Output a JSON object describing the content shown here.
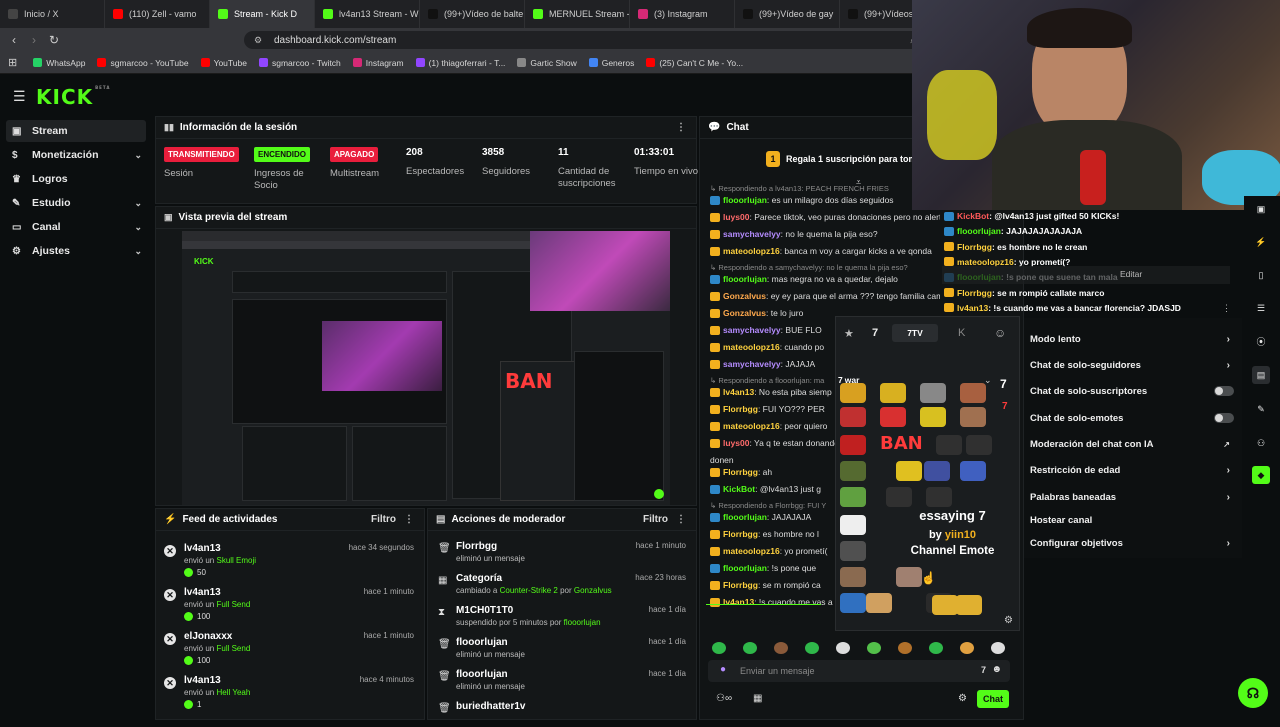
{
  "browser": {
    "tabs": [
      {
        "label": "Inicio / X",
        "color": "#444"
      },
      {
        "label": "(110) Zell - vamo",
        "color": "#ff0000"
      },
      {
        "label": "Stream - Kick D",
        "color": "#53fc18",
        "active": true
      },
      {
        "label": "lv4an13 Stream - W",
        "color": "#53fc18"
      },
      {
        "label": "(99+)Vídeo de balte",
        "color": "#111"
      },
      {
        "label": "MERNUEL Stream -",
        "color": "#53fc18"
      },
      {
        "label": "(3) Instagram",
        "color": "#d62976"
      },
      {
        "label": "(99+)Vídeo de gay",
        "color": "#111"
      },
      {
        "label": "(99+)Vídeos de B",
        "color": "#111"
      }
    ],
    "url": "dashboard.kick.com/stream",
    "bookmarks": [
      {
        "label": "WhatsApp",
        "color": "#25d366"
      },
      {
        "label": "sgmarcoo - YouTube",
        "color": "#ff0000"
      },
      {
        "label": "YouTube",
        "color": "#ff0000"
      },
      {
        "label": "sgmarcoo - Twitch",
        "color": "#9146ff"
      },
      {
        "label": "Instagram",
        "color": "#d62976"
      },
      {
        "label": "(1) thiagoferrari - T...",
        "color": "#9146ff"
      },
      {
        "label": "Gartic Show",
        "color": "#888"
      },
      {
        "label": "Generos",
        "color": "#4285f4"
      },
      {
        "label": "(25) Can't C Me - Yo...",
        "color": "#ff0000"
      }
    ]
  },
  "brand": {
    "logo": "KICK",
    "beta": "BETA",
    "accent": "#53fc18"
  },
  "sidebar": {
    "items": [
      {
        "label": "Stream",
        "icon": "video-icon",
        "active": true
      },
      {
        "label": "Monetización",
        "icon": "money-icon",
        "chevron": true
      },
      {
        "label": "Logros",
        "icon": "trophy-icon"
      },
      {
        "label": "Estudio",
        "icon": "studio-icon",
        "chevron": true
      },
      {
        "label": "Canal",
        "icon": "channel-icon",
        "chevron": true
      },
      {
        "label": "Ajustes",
        "icon": "gear-icon",
        "chevron": true
      }
    ]
  },
  "session": {
    "title": "Información de la sesión",
    "stats": [
      {
        "badge": "TRANSMITIENDO",
        "badge_color": "#e91e3c",
        "label": "Sesión"
      },
      {
        "badge": "ENCENDIDO",
        "badge_color": "#53fc18",
        "label": "Ingresos de Socio"
      },
      {
        "badge": "APAGADO",
        "badge_color": "#e91e3c",
        "label": "Multistream"
      },
      {
        "value": "208",
        "label": "Espectadores"
      },
      {
        "value": "3858",
        "label": "Seguidores"
      },
      {
        "value": "11",
        "label": "Cantidad de suscripciones"
      },
      {
        "value": "01:33:01",
        "label": "Tiempo en vivo"
      }
    ]
  },
  "preview": {
    "title": "Vista previa del stream",
    "ban_text": "BAN"
  },
  "feed": {
    "title": "Feed de actividades",
    "filter": "Filtro",
    "items": [
      {
        "name": "lv4an13",
        "time": "hace 34 segundos",
        "action": "envió un",
        "item": "Skull Emoji",
        "amount": "50"
      },
      {
        "name": "lv4an13",
        "time": "hace 1 minuto",
        "action": "envió un",
        "item": "Full Send",
        "amount": "100"
      },
      {
        "name": "elJonaxxx",
        "time": "hace 1 minuto",
        "action": "envió un",
        "item": "Full Send",
        "amount": "100"
      },
      {
        "name": "lv4an13",
        "time": "hace 4 minutos",
        "action": "envió un",
        "item": "Hell Yeah",
        "amount": "1"
      }
    ]
  },
  "modactions": {
    "title": "Acciones de moderador",
    "filter": "Filtro",
    "items": [
      {
        "name": "Florrbgg",
        "time": "hace 1 minuto",
        "desc": "eliminó un mensaje",
        "icon": "trash-icon"
      },
      {
        "name": "Categoría",
        "time": "hace 23 horas",
        "desc_pre": "cambiado a",
        "desc_hl": "Counter-Strike 2",
        "desc_mid": "por",
        "desc_user": "Gonzalvus",
        "icon": "category-icon"
      },
      {
        "name": "M1CH0T1T0",
        "time": "hace 1 día",
        "desc_pre": "suspendido por 5 minutos por",
        "desc_user": "flooorlujan",
        "icon": "hourglass-icon"
      },
      {
        "name": "flooorlujan",
        "time": "hace 1 día",
        "desc": "eliminó un mensaje",
        "icon": "trash-icon"
      },
      {
        "name": "flooorlujan",
        "time": "hace 1 día",
        "desc": "eliminó un mensaje",
        "icon": "trash-icon"
      },
      {
        "name": "buriedhatter1v",
        "time": "",
        "desc": "",
        "icon": "trash-icon"
      }
    ]
  },
  "chat": {
    "title": "Chat",
    "sub_gift": "Regala 1 suscripción para tomar l",
    "reply_prefix": "Respondiendo a",
    "lines": [
      {
        "reply": "lv4an13: PEACH FRENCH FRIES"
      },
      {
        "user": "flooorlujan",
        "color": "#53fc18",
        "msg": ": es un milagro dos días seguidos"
      },
      {
        "user": "luys00",
        "color": "#ff6b6b",
        "msg": ": Parece tiktok, veo puras donaciones pero no alertas"
      },
      {
        "user": "samychavelyy",
        "color": "#b58cff",
        "msg": ": no le quema la pija eso?"
      },
      {
        "user": "mateoolopz16",
        "color": "#ffd23f",
        "msg": ": banca m voy a cargar kicks a ve qonda"
      },
      {
        "reply": "samychavelyy: no le quema la pija eso?"
      },
      {
        "user": "flooorlujan",
        "color": "#53fc18",
        "msg": ": mas negra no va a quedar, dejalo"
      },
      {
        "user": "Gonzalvus",
        "color": "#ffa94d",
        "msg": ": ey ey para que el arma ??? tengo familia campeo"
      },
      {
        "user": "Gonzalvus",
        "color": "#ffa94d",
        "msg": ": te lo juro"
      },
      {
        "user": "samychavelyy",
        "color": "#b58cff",
        "msg": ": BUE FLO"
      },
      {
        "user": "mateoolopz16",
        "color": "#ffd23f",
        "msg": ": cuando po"
      },
      {
        "user": "samychavelyy",
        "color": "#b58cff",
        "msg": ": JAJAJA"
      },
      {
        "reply": "flooorlujan: ma"
      },
      {
        "user": "lv4an13",
        "color": "#ffd23f",
        "msg": ": No esta piba siemp"
      },
      {
        "user": "Florrbgg",
        "color": "#ffd23f",
        "msg": ": FUI YO??? PER"
      },
      {
        "user": "mateoolopz16",
        "color": "#ffd23f",
        "msg": ": peor quiero"
      },
      {
        "user": "luys00",
        "color": "#ff6b6b",
        "msg": ": Ya q te estan donando p"
      },
      {
        "cont": "donen"
      },
      {
        "user": "Florrbgg",
        "color": "#ffd23f",
        "msg": ": ah"
      },
      {
        "user": "KickBot",
        "color": "#53fc18",
        "msg": ": @lv4an13 just g"
      },
      {
        "reply": "Florrbgg: FUI Y"
      },
      {
        "user": "flooorlujan",
        "color": "#53fc18",
        "msg": ": JAJAJAJA"
      },
      {
        "user": "Florrbgg",
        "color": "#ffd23f",
        "msg": ": es hombre no l"
      },
      {
        "user": "mateoolopz16",
        "color": "#ffd23f",
        "msg": ": yo prometí("
      },
      {
        "user": "flooorlujan",
        "color": "#53fc18",
        "msg": ": !s pone que"
      },
      {
        "user": "Florrbgg",
        "color": "#ffd23f",
        "msg": ": se m rompió ca"
      },
      {
        "user": "lv4an13",
        "color": "#ffd23f",
        "msg": ": !s cuando me vas a"
      }
    ],
    "input_placeholder": "Enviar un mensaje",
    "send_label": "Chat"
  },
  "overlay_chat": [
    {
      "user": "KickBot",
      "color": "#53fc18",
      "msg": ": @lv4an13 just gifted 50 KICKs!"
    },
    {
      "user": "flooorlujan",
      "color": "#53fc18",
      "msg": ": JAJAJAJAJAJAJA"
    },
    {
      "user": "Florrbgg",
      "color": "#ffd23f",
      "msg": ": es hombre no le crean"
    },
    {
      "user": "mateoolopz16",
      "color": "#ffd23f",
      "msg": ": yo prometí(?"
    },
    {
      "user": "flooorlujan",
      "color": "#53fc18",
      "msg": ": !s pone que suene tan mala"
    },
    {
      "user": "Florrbgg",
      "color": "#ffd23f",
      "msg": ": se m rompió callate marco"
    },
    {
      "user": "lv4an13",
      "color": "#ffd23f",
      "msg": ": !s cuando me vas a bancar florencia? JDASJD"
    }
  ],
  "edit_label": "Editar",
  "emote_picker": {
    "tab_7tv": "7TV",
    "search_value": "war",
    "tooltip_name": "essaying",
    "tooltip_by": "by",
    "tooltip_author": "yiin10",
    "tooltip_kind": "Channel Emote",
    "ban_text": "BAN"
  },
  "chat_settings": [
    {
      "label": "Modo lento",
      "type": "arrow"
    },
    {
      "label": "Chat de solo-seguidores",
      "type": "arrow"
    },
    {
      "label": "Chat de solo-suscriptores",
      "type": "toggle"
    },
    {
      "label": "Chat de solo-emotes",
      "type": "toggle"
    },
    {
      "label": "Moderación del chat con IA",
      "type": "external"
    },
    {
      "label": "Restricción de edad",
      "type": "arrow"
    },
    {
      "label": "Palabras baneadas",
      "type": "arrow"
    },
    {
      "label": "Hostear canal",
      "type": "none"
    },
    {
      "label": "Configurar objetivos",
      "type": "arrow"
    }
  ]
}
